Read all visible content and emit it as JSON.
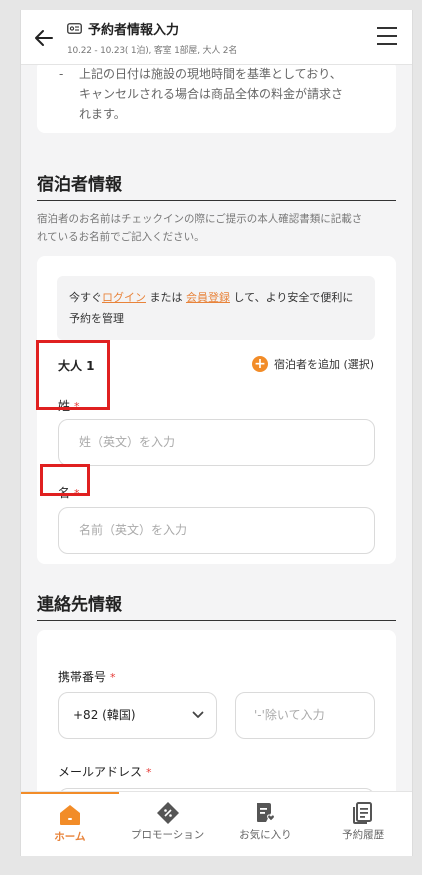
{
  "header": {
    "title": "予約者情報入力",
    "subtitle": "10.22 - 10.23( 1泊), 客室 1部屋, 大人 2名"
  },
  "policy": {
    "lines": [
      "上記の日付は施設の現地時間を基準としており、",
      "キャンセルされる場合は商品全体の料金が請求さ",
      "れます。"
    ]
  },
  "guest_section": {
    "title": "宿泊者情報",
    "note_line1": "宿泊者のお名前はチェックインの際にご提示の本人確認書類に記載さ",
    "note_line2": "れているお名前でご記入ください。",
    "login_prefix": "今すぐ",
    "login_link": "ログイン",
    "login_mid": "または",
    "register_link": "会員登録",
    "login_suffix1": "して、より安全で便利に",
    "login_suffix2": "予約を管理",
    "adult_label": "大人 1",
    "add_guest_label": "宿泊者を追加 (選択)",
    "last_name_label": "姓",
    "last_name_placeholder": "姓（英文）を入力",
    "first_name_label": "名",
    "first_name_placeholder": "名前（英文）を入力",
    "required_mark": "*"
  },
  "contact_section": {
    "title": "連絡先情報",
    "phone_label": "携帯番号",
    "country_code": "+82 (韓国)",
    "phone_placeholder": "'-'除いて入力",
    "email_label": "メールアドレス",
    "required_mark": "*"
  },
  "bottom_nav": {
    "items": [
      {
        "label": "ホーム",
        "icon": "home-icon"
      },
      {
        "label": "プロモーション",
        "icon": "promotion-tag-icon"
      },
      {
        "label": "お気に入り",
        "icon": "favorite-document-icon"
      },
      {
        "label": "予約履歴",
        "icon": "booking-history-icon"
      }
    ]
  },
  "colors": {
    "accent": "#f28c28",
    "link": "#e8833a",
    "required": "#e53935",
    "highlight_box": "#e02020"
  }
}
